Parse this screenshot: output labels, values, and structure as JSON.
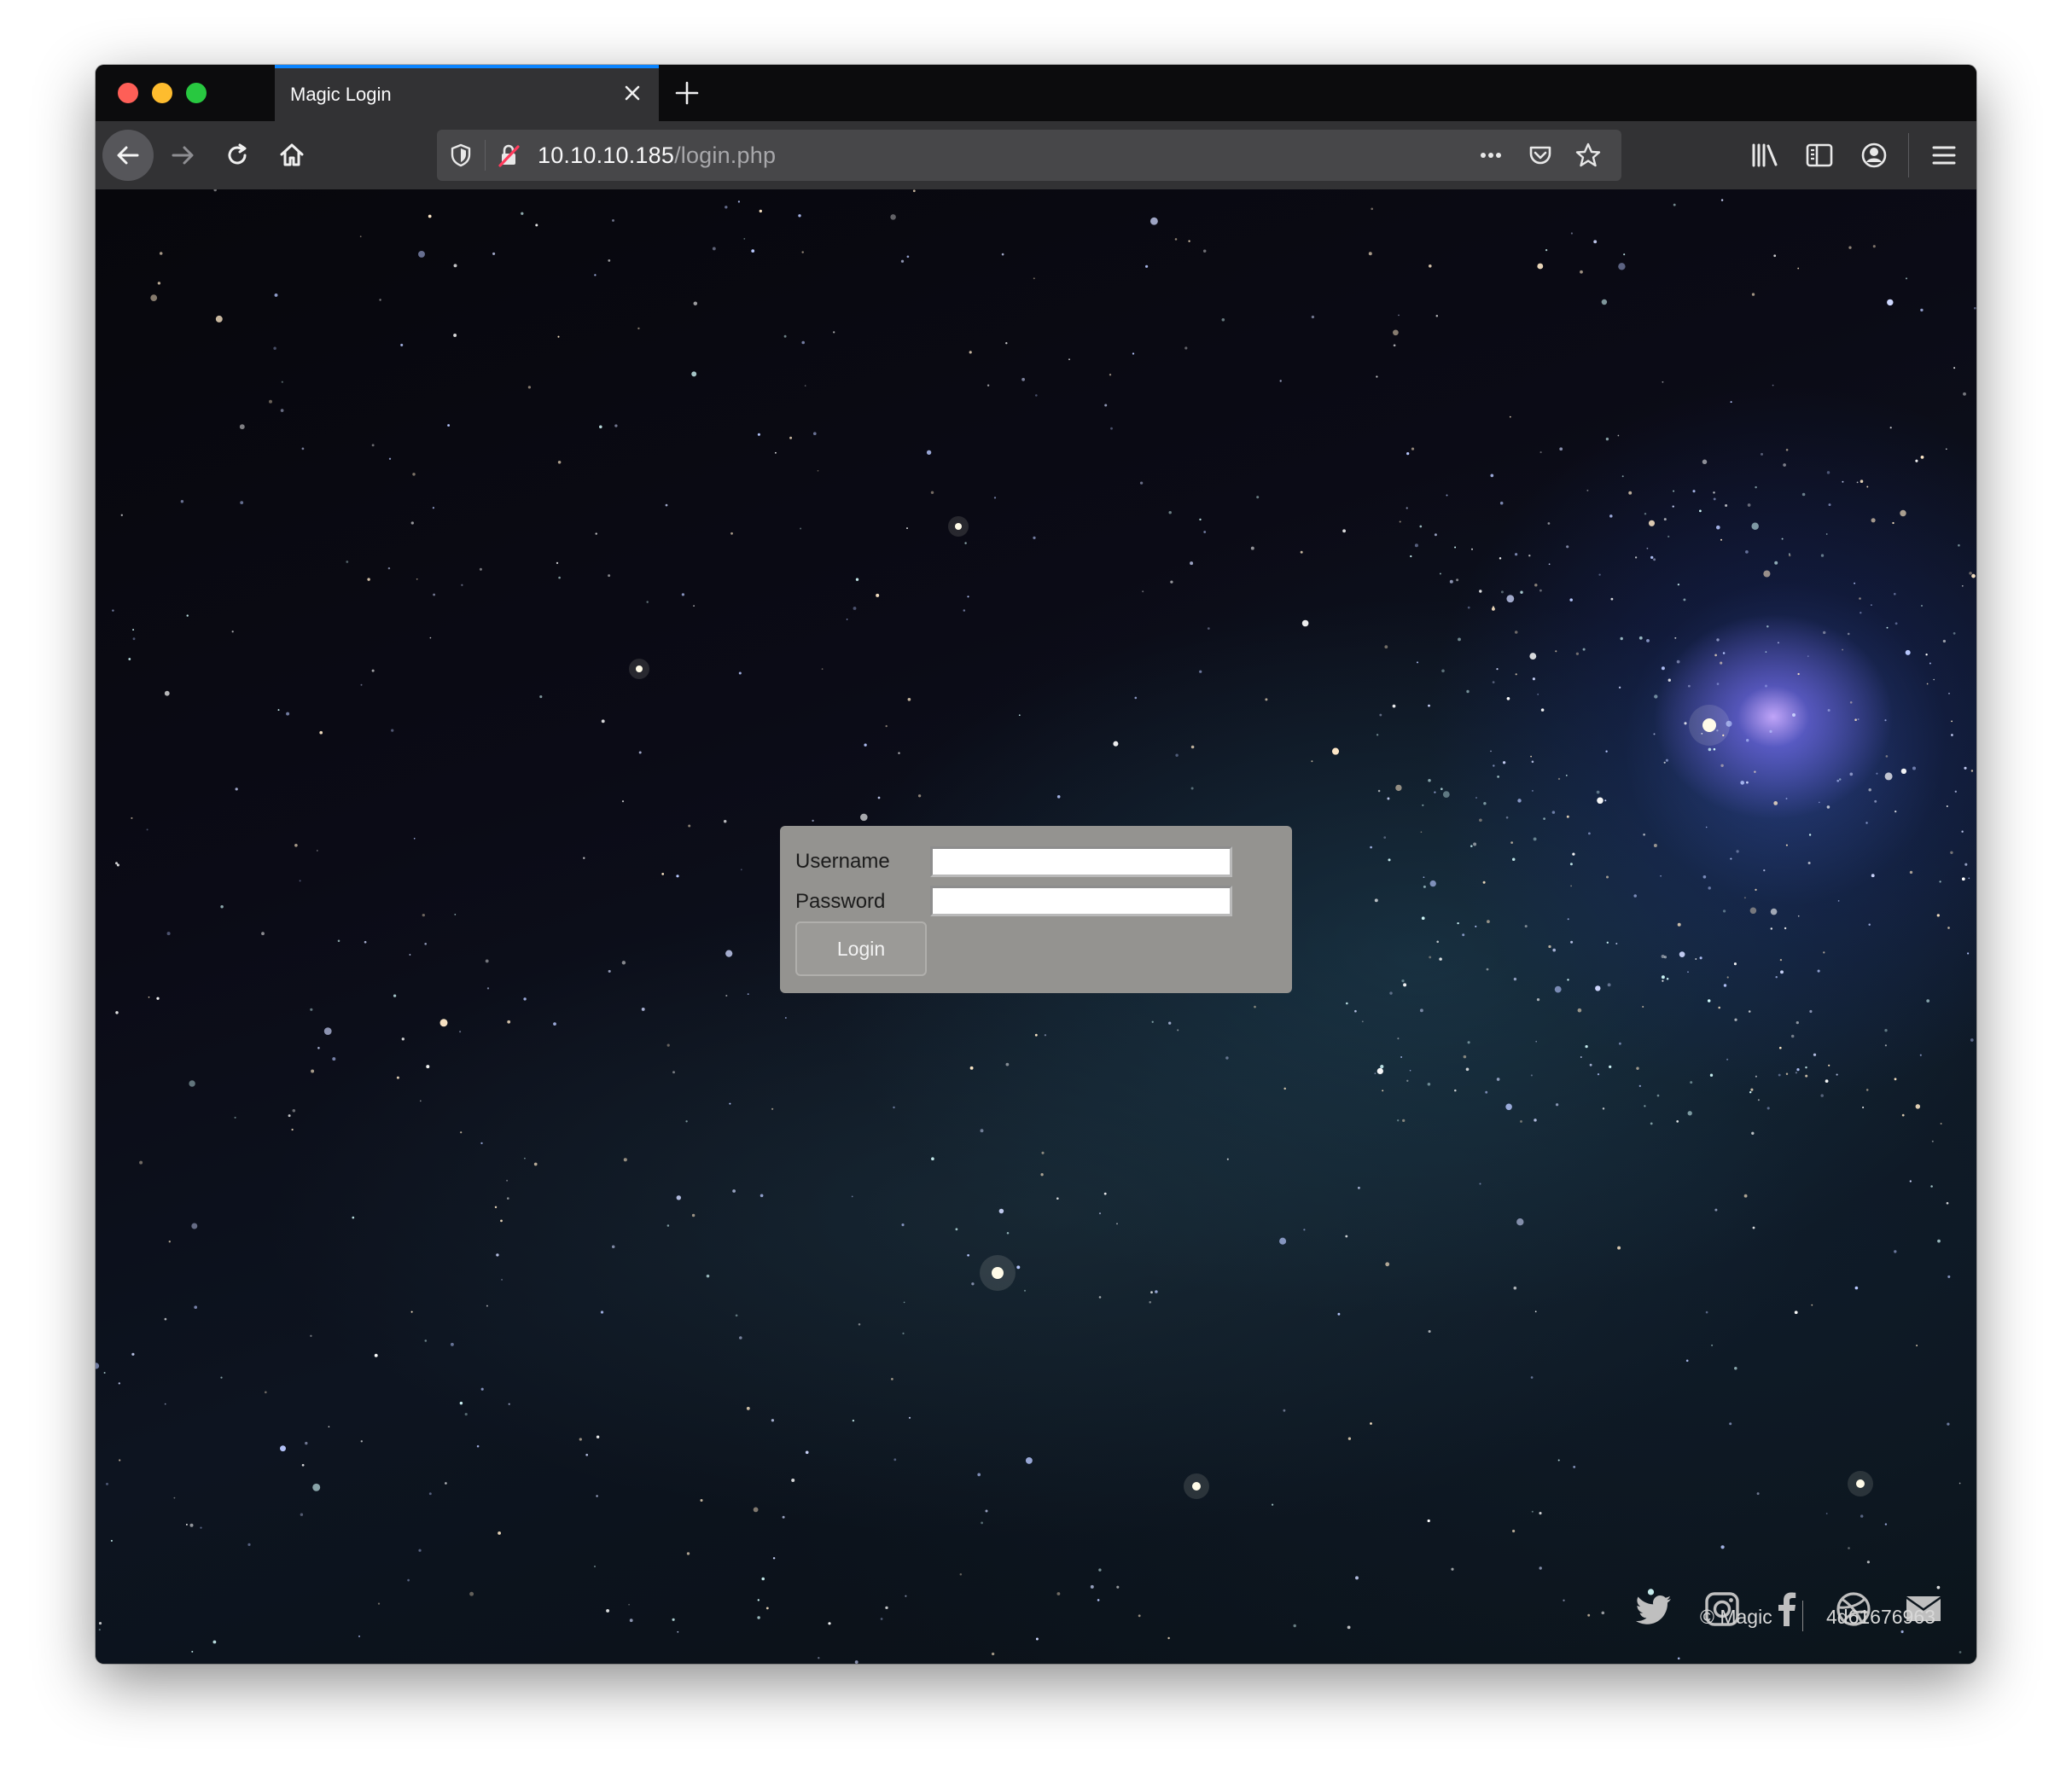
{
  "browser": {
    "tab_title": "Magic Login",
    "url_host": "10.10.10.185",
    "url_path": "/login.php"
  },
  "login": {
    "username_label": "Username",
    "password_label": "Password",
    "username_value": "",
    "password_value": "",
    "submit_label": "Login"
  },
  "footer": {
    "copyright": "© Magic",
    "hash": "4d61676963",
    "social_icons": [
      "twitter-icon",
      "instagram-icon",
      "facebook-icon",
      "dribbble-icon",
      "mail-icon"
    ]
  },
  "colors": {
    "tab_accent": "#0a84ff",
    "login_panel": "#949390",
    "chrome_dark": "#0c0c0d",
    "toolbar": "#323234"
  }
}
